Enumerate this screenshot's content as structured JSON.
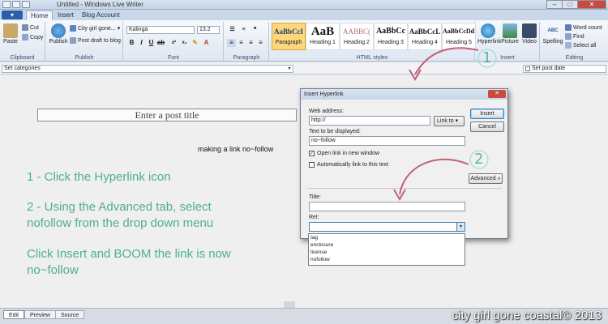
{
  "window": {
    "title": "Untitled - Windows Live Writer",
    "min": "–",
    "max": "□",
    "close": "✕"
  },
  "tabs": {
    "app_menu": "▾",
    "items": [
      {
        "label": "Home"
      },
      {
        "label": "Insert"
      },
      {
        "label": "Blog Account"
      }
    ]
  },
  "ribbon": {
    "clipboard": {
      "label": "Clipboard",
      "paste": "Paste",
      "cut": "Cut",
      "copy": "Copy"
    },
    "publish": {
      "label": "Publish",
      "publish_btn": "Publish",
      "blog_name": "City girl gone...",
      "post_draft": "Post draft to blog"
    },
    "font": {
      "label": "Font",
      "family": "Kalinga",
      "size": "13.2"
    },
    "paragraph": {
      "label": "Paragraph"
    },
    "styles": {
      "label": "HTML styles",
      "items": [
        {
          "preview": "AaBbCcI",
          "name": "Paragraph"
        },
        {
          "preview": "AaB",
          "name": "Heading 1"
        },
        {
          "preview": "AABBC(",
          "name": "Heading 2"
        },
        {
          "preview": "AaBbCc",
          "name": "Heading 3"
        },
        {
          "preview": "AaBbCcL",
          "name": "Heading 4"
        },
        {
          "preview": "AaBbCcDdI",
          "name": "Heading 5"
        }
      ]
    },
    "insert": {
      "label": "Insert",
      "hyperlink": "Hyperlink",
      "picture": "Picture",
      "video": "Video"
    },
    "editing": {
      "label": "Editing",
      "spelling": "Spelling",
      "word_count": "Word count",
      "find": "Find",
      "select_all": "Select all"
    }
  },
  "category_bar": {
    "categories": "Set categories",
    "post_date": "Set post date"
  },
  "editor": {
    "post_title_placeholder": "Enter a post title",
    "body_text": "making a link no~follow",
    "instructions": [
      "1 - Click the Hyperlink icon",
      "2 - Using the Advanced tab, select",
      "nofollow from the drop down menu",
      "Click Insert and BOOM the link is now",
      "no~follow"
    ],
    "annotation_1": "1",
    "annotation_2": "2"
  },
  "dialog": {
    "title": "Insert Hyperlink",
    "close": "✕",
    "web_address_label": "Web address:",
    "web_address_value": "http://",
    "link_to": "Link to",
    "text_label": "Text to be displayed:",
    "text_value": "no~follow",
    "open_new_window": "Open link in new window",
    "auto_link": "Automatically link to this text",
    "insert": "Insert",
    "cancel": "Cancel",
    "advanced": "Advanced »",
    "title_label": "Title:",
    "rel_label": "Rel:",
    "rel_options": [
      "tag",
      "enclosure",
      "license",
      "nofollow"
    ]
  },
  "bottom_tabs": [
    {
      "label": "Edit"
    },
    {
      "label": "Preview"
    },
    {
      "label": "Source"
    }
  ],
  "watermark": "city girl gone coastal© 2013",
  "colors": {
    "instruction_text": "#4fae97",
    "annotation_arrow": "#c0607a",
    "selected_style": "#fcd77e"
  }
}
